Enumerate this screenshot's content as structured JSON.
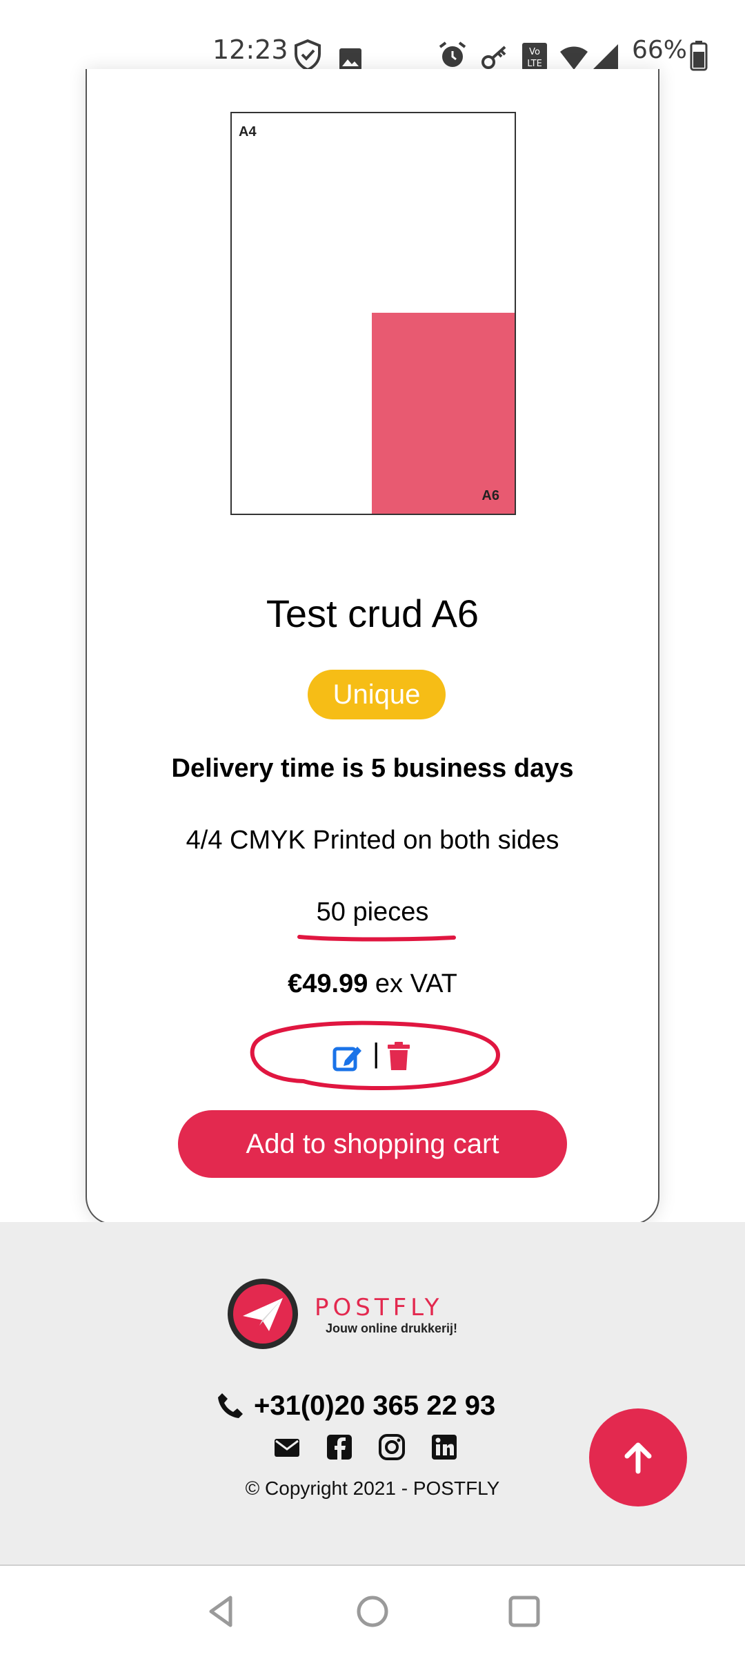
{
  "status_bar": {
    "time": "12:23",
    "battery_percent": "66%",
    "icons": [
      "shield-icon",
      "image-icon",
      "alarm-icon",
      "key-icon",
      "volte-icon",
      "wifi-icon",
      "signal-icon",
      "battery-icon"
    ]
  },
  "product": {
    "diagram": {
      "outer_label": "A4",
      "inner_label": "A6"
    },
    "title": "Test crud A6",
    "badge": "Unique",
    "delivery": "Delivery time is 5 business days",
    "printing": "4/4 CMYK Printed on both sides",
    "quantity": "50 pieces",
    "price": "€49.99",
    "price_suffix": " ex VAT",
    "separator": "|",
    "cart_button": "Add to shopping cart"
  },
  "footer": {
    "logo_word": "POSTFLY",
    "logo_tagline": "Jouw online drukkerij!",
    "phone": "+31(0)20 365 22 93",
    "social_icons": [
      "email-icon",
      "facebook-icon",
      "instagram-icon",
      "linkedin-icon"
    ],
    "copyright": "© Copyright 2021 - POSTFLY"
  },
  "colors": {
    "accent": "#e3294f",
    "badge": "#f6bd16",
    "edit": "#1a73e8",
    "a6_fill": "#e85a71",
    "annotation": "#e01640"
  }
}
